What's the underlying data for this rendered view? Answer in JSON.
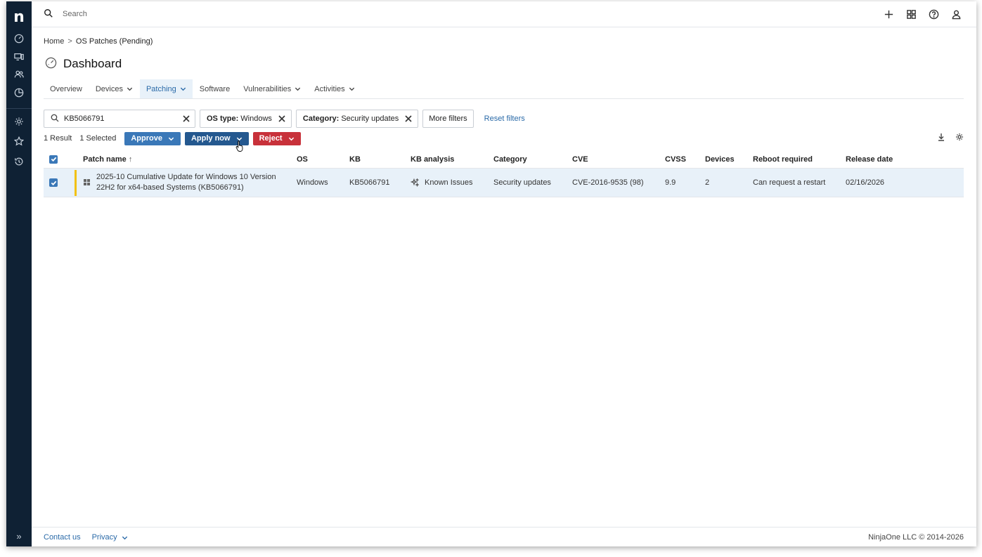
{
  "app": {
    "logo": "n"
  },
  "topbar": {
    "search_placeholder": "Search"
  },
  "breadcrumb": {
    "home": "Home",
    "separator": ">",
    "current": "OS Patches (Pending)"
  },
  "page": {
    "title": "Dashboard"
  },
  "tabs": [
    {
      "label": "Overview",
      "has_dropdown": false,
      "active": false
    },
    {
      "label": "Devices",
      "has_dropdown": true,
      "active": false
    },
    {
      "label": "Patching",
      "has_dropdown": true,
      "active": true
    },
    {
      "label": "Software",
      "has_dropdown": false,
      "active": false
    },
    {
      "label": "Vulnerabilities",
      "has_dropdown": true,
      "active": false
    },
    {
      "label": "Activities",
      "has_dropdown": true,
      "active": false
    }
  ],
  "filters": {
    "search_value": "KB5066791",
    "chips": [
      {
        "key": "OS type:",
        "value": "Windows"
      },
      {
        "key": "Category:",
        "value": "Security updates"
      }
    ],
    "more_filters": "More filters",
    "reset_filters": "Reset filters"
  },
  "actions": {
    "result_count": "1 Result",
    "selected_count": "1 Selected",
    "approve": "Approve",
    "apply_now": "Apply now",
    "reject": "Reject"
  },
  "table": {
    "columns": [
      "Patch name",
      "OS",
      "KB",
      "KB analysis",
      "Category",
      "CVE",
      "CVSS",
      "Devices",
      "Reboot required",
      "Release date"
    ],
    "sort_indicator": "↑",
    "rows": [
      {
        "selected": true,
        "patch_name_line1": "2025-10 Cumulative Update for Windows 10 Version",
        "patch_name_line2": "22H2 for x64-based Systems (KB5066791)",
        "os": "Windows",
        "kb": "KB5066791",
        "kb_analysis": "Known Issues",
        "category": "Security updates",
        "cve": "CVE-2016-9535 (98)",
        "cvss": "9.9",
        "devices": "2",
        "reboot_required": "Can request a restart",
        "release_date": "02/16/2026"
      }
    ]
  },
  "footer": {
    "contact": "Contact us",
    "privacy": "Privacy",
    "copyright": "NinjaOne LLC © 2014-2026"
  },
  "colors": {
    "sidebar": "#0f2134",
    "primary": "#3a78b8",
    "apply": "#24588f",
    "danger": "#c8313a",
    "status_bar": "#f2c10f",
    "row_selected": "#e8f1f9"
  }
}
